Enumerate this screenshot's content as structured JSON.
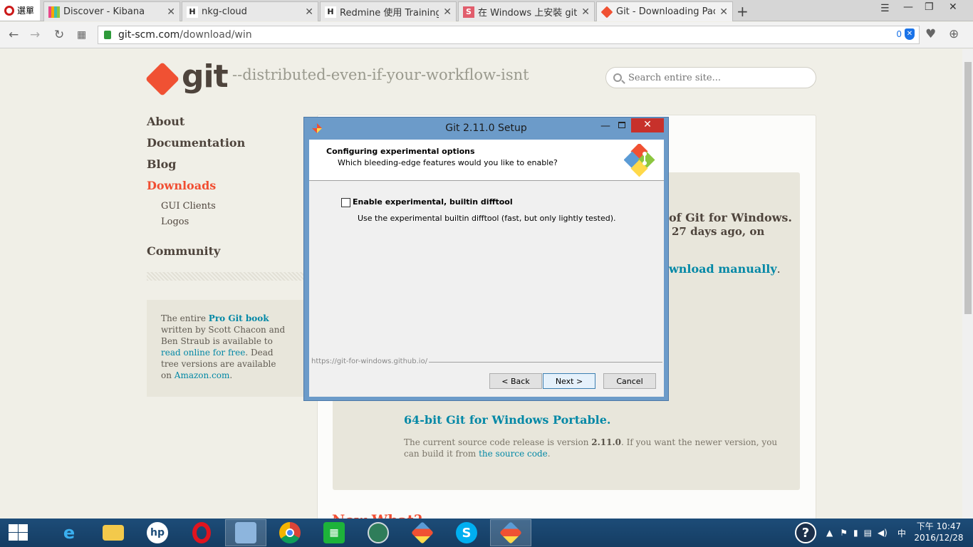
{
  "browser": {
    "menu_label": "選單",
    "tabs": [
      {
        "title": "Discover - Kibana",
        "favicon_color": "#e8478b"
      },
      {
        "title": "nkg-cloud",
        "favicon_color": "#2b2b2b"
      },
      {
        "title": "Redmine 使用 Training - (",
        "favicon_color": "#2b2b2b"
      },
      {
        "title": "在 Windows 上安裝 git by",
        "favicon_color": "#e15d6c"
      },
      {
        "title": "Git - Downloading Packa",
        "favicon_color": "#f05133"
      }
    ],
    "url_host": "git-scm.com",
    "url_path": "/download/win",
    "blocked_count": "0"
  },
  "page": {
    "logo_text": "git",
    "tagline": "--distributed-even-if-your-workflow-isnt",
    "search_placeholder": "Search entire site...",
    "nav": {
      "about": "About",
      "documentation": "Documentation",
      "blog": "Blog",
      "downloads": "Downloads",
      "gui_clients": "GUI Clients",
      "logos": "Logos",
      "community": "Community"
    },
    "promo": {
      "prefix": "The entire ",
      "book": "Pro Git book",
      "middle": " written by Scott Chacon and Ben Straub is available to ",
      "read_link": "read online for free",
      "suffix": ". Dead tree versions are available on ",
      "amazon": "Amazon.com",
      "end": "."
    },
    "main": {
      "line1": "of Git for Windows.",
      "line2": "27 days ago, on",
      "manual_link": "wnload manually",
      "manual_end": ".",
      "portable_link": "64-bit Git for Windows Portable.",
      "source_prefix": "The current source code release is version ",
      "source_version": "2.11.0",
      "source_middle": ". If you want the newer version, you can build it from ",
      "source_link": "the source code",
      "source_end": ".",
      "now_what": "Now What?"
    }
  },
  "dialog": {
    "title": "Git 2.11.0 Setup",
    "heading": "Configuring experimental options",
    "subheading": "Which bleeding-edge features would you like to enable?",
    "checkbox_label": "Enable experimental, builtin difftool",
    "checkbox_checked": false,
    "description": "Use the experimental builtin difftool (fast, but only lightly tested).",
    "footer_url": "https://git-for-windows.github.io/",
    "back_label": "< Back",
    "next_label": "Next >",
    "cancel_label": "Cancel"
  },
  "taskbar": {
    "apps": [
      "internet-explorer",
      "file-explorer",
      "hp",
      "opera",
      "remote-desktop",
      "chrome",
      "store",
      "globe",
      "git-setup",
      "skype",
      "git-setup-active"
    ],
    "ime": "中",
    "time": "下午 10:47",
    "date": "2016/12/28",
    "help": "?"
  }
}
